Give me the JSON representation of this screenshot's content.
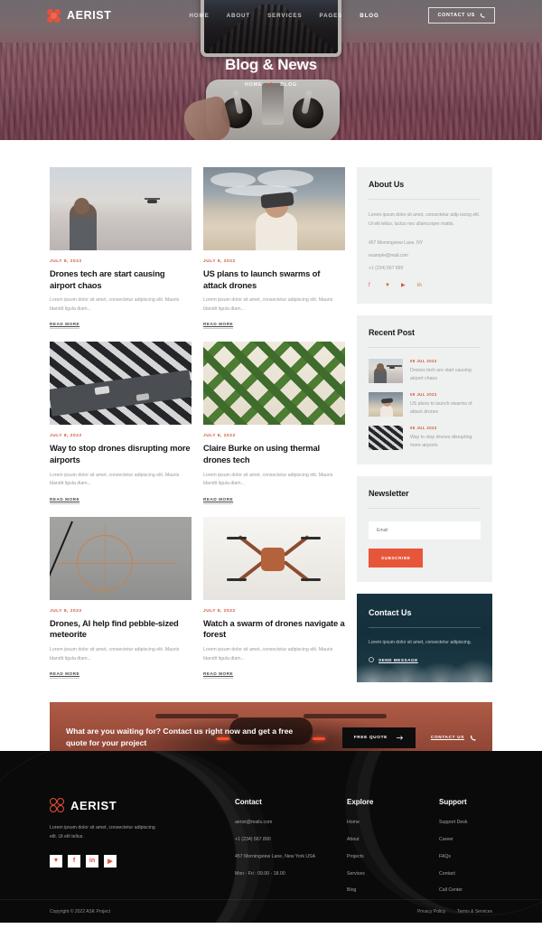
{
  "header": {
    "logo_text": "AERIST",
    "nav": [
      {
        "label": "HOME",
        "active": false
      },
      {
        "label": "ABOUT",
        "active": false
      },
      {
        "label": "SERVICES",
        "active": false
      },
      {
        "label": "PAGES",
        "active": false
      },
      {
        "label": "BLOG",
        "active": true
      }
    ],
    "contact_button": "CONTACT US",
    "phone_icon": "phone-icon"
  },
  "hero": {
    "title": "Blog & News",
    "breadcrumb": [
      {
        "label": "HOME"
      },
      {
        "label": "BLOG"
      }
    ],
    "separator_icon": "plus-icon"
  },
  "posts": [
    {
      "date": "JULY 8, 2022",
      "title": "Drones tech are start causing airport chaos",
      "excerpt": "Lorem ipsum dolor sit amet, consectetur adipiscing elit. Mauris blandit ligula diam...",
      "read_more": "READ MORE",
      "image": "man-with-drone-controller-at-sunset"
    },
    {
      "date": "JULY 8, 2022",
      "title": "US plans to launch swarms of attack drones",
      "excerpt": "Lorem ipsum dolor sit amet, consectetur adipiscing elit. Mauris blandit ligula diam...",
      "read_more": "READ MORE",
      "image": "person-wearing-fpv-goggles-in-desert"
    },
    {
      "date": "JULY 8, 2022",
      "title": "Way to stop drones disrupting more airports",
      "excerpt": "Lorem ipsum dolor sit amet, consectetur adipiscing elit. Mauris blandit ligula diam...",
      "read_more": "READ MORE",
      "image": "aerial-view-of-striped-crosswalk-road"
    },
    {
      "date": "JULY 8, 2022",
      "title": "Claire Burke on using thermal drones tech",
      "excerpt": "Lorem ipsum dolor sit amet, consectetur adipiscing elit. Mauris blandit ligula diam...",
      "read_more": "READ MORE",
      "image": "aerial-view-of-green-hedge-maze"
    },
    {
      "date": "JULY 8, 2022",
      "title": "Drones, AI help find pebble-sized meteorite",
      "excerpt": "Lorem ipsum dolor sit amet, consectetur adipiscing elit. Mauris blandit ligula diam...",
      "read_more": "READ MORE",
      "image": "aerial-view-of-road-with-orange-circle-overlay"
    },
    {
      "date": "JULY 8, 2022",
      "title": "Watch a swarm of drones navigate a forest",
      "excerpt": "Lorem ipsum dolor sit amet, consectetur adipiscing elit. Mauris blandit ligula diam...",
      "read_more": "READ MORE",
      "image": "orange-quadcopter-drone-top-view"
    }
  ],
  "sidebar": {
    "about": {
      "title": "About Us",
      "text": "Lorem ipsum dolor sit amet, consectetur adip iscing elit. Ut elit tellus, luctus nec ullamcorper mattis.",
      "address": "457 Morningview Lane, NY",
      "email": "example@mail.com",
      "phone": "+1 (234) 567 890",
      "socials": [
        "facebook-icon",
        "twitter-icon",
        "youtube-icon",
        "linkedin-icon"
      ]
    },
    "recent": {
      "title": "Recent Post",
      "items": [
        {
          "date": "08 JUL 2022",
          "title": "Drones tech are start causing airport chaos",
          "thumb": "man-with-drone-controller-thumb"
        },
        {
          "date": "08 JUL 2022",
          "title": "US plans to launch swarms of attack drones",
          "thumb": "fpv-goggles-person-thumb"
        },
        {
          "date": "08 JUL 2022",
          "title": "Way to stop drones disrupting more airports",
          "thumb": "striped-crosswalk-thumb"
        }
      ]
    },
    "newsletter": {
      "title": "Newsletter",
      "placeholder": "Email",
      "value": "",
      "button": "SUBSCRIBE"
    },
    "contact_card": {
      "title": "Contact Us",
      "text": "Lorem ipsum dolor sit amet, consectetur adipiscing.",
      "link": "SEND MESSAGE",
      "link_icon": "arrow-circle-icon"
    }
  },
  "cta": {
    "text": "What are you waiting for? Contact us right now and get a free quote for your project",
    "quote_button": "FREE QUOTE",
    "quote_icon": "arrow-right-icon",
    "contact_link": "CONTACT US",
    "contact_icon": "phone-icon"
  },
  "footer": {
    "logo_text": "AERIST",
    "description": "Lorem ipsum dolor sit amet, consectetur adipiscing elit. Ut elit tellus.",
    "socials": [
      "twitter-icon",
      "facebook-icon",
      "linkedin-icon",
      "youtube-icon"
    ],
    "columns": [
      {
        "title": "Contact",
        "items": [
          "aerist@mails.com",
          "+1 (234) 567 890",
          "457 Morningview Lane, New York USA",
          "Mon - Fri : 09.00 - 18.00"
        ]
      },
      {
        "title": "Explore",
        "items": [
          "Home",
          "About",
          "Projects",
          "Services",
          "Blog"
        ]
      },
      {
        "title": "Support",
        "items": [
          "Support Desk",
          "Career",
          "FAQs",
          "Contact",
          "Call Center"
        ]
      }
    ],
    "copyright": "Copyright © 2022 ASK Project",
    "legal": [
      "Privacy Policy",
      "Terms & Services"
    ]
  },
  "colors": {
    "accent": "#e8563a",
    "accent_dark": "#d2563c",
    "dark": "#0a0a0a",
    "widget_bg": "#eff0f0",
    "contact_card_bg": "#16333f"
  }
}
